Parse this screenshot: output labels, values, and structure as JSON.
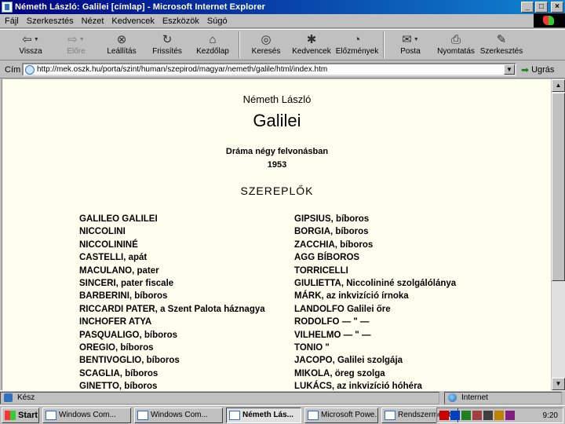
{
  "window": {
    "title": "Németh László: Galilei [címlap] - Microsoft Internet Explorer",
    "min": "_",
    "max": "□",
    "close": "×"
  },
  "menu": [
    "Fájl",
    "Szerkesztés",
    "Nézet",
    "Kedvencek",
    "Eszközök",
    "Súgó"
  ],
  "toolbar": {
    "back": "Vissza",
    "forward": "Előre",
    "stop": "Leállítás",
    "refresh": "Frissítés",
    "home": "Kezdőlap",
    "search": "Keresés",
    "favorites": "Kedvencek",
    "history": "Előzmények",
    "mail": "Posta",
    "print": "Nyomtatás",
    "edit": "Szerkesztés"
  },
  "address": {
    "label": "Cím",
    "url": "http://mek.oszk.hu/porta/szint/human/szepirod/magyar/nemeth/galile/html/index.htm",
    "go": "Ugrás"
  },
  "page": {
    "author": "Németh László",
    "title": "Galilei",
    "genre": "Dráma négy felvonásban",
    "year": "1953",
    "cast_heading": "SZEREPLŐK",
    "cast_left": [
      "GALILEO GALILEI",
      "NICCOLINI",
      "NICCOLININÉ",
      "CASTELLI, apát",
      "MACULANO, pater",
      "SINCERI, pater fiscale",
      "BARBERINI, bíboros",
      "RICCARDI PATER, a Szent Palota háznagya",
      "INCHOFER ATYA",
      "PASQUALIGO, bíboros",
      "OREGIO, bíboros",
      "BENTIVOGLIO, bíboros",
      "SCAGLIA, bíboros",
      "GINETTO, bíboros"
    ],
    "cast_right": [
      "GIPSIUS, bíboros",
      "BORGIA, bíboros",
      "ZACCHIA, bíboros",
      "AGG BÍBOROS",
      "TORRICELLI",
      "GIULIETTA, Niccolininé szolgálólánya",
      "MÁRK, az inkvizíció írnoka",
      "LANDOLFO  Galilei őre",
      "RODOLFO       — \" —",
      "VILHELMO      — \" —",
      "TONIO              \"",
      "JACOPO, Galilei szolgája",
      "MIKOLA, öreg szolga",
      "LUKÁCS, az inkvizíció hóhéra"
    ]
  },
  "status": {
    "left": "Kész",
    "zone": "Internet"
  },
  "taskbar": {
    "start": "Start",
    "tasks": [
      "Windows Com...",
      "Windows Com...",
      "Németh Lás...",
      "Microsoft Powe...",
      "Rendszermonitor"
    ],
    "clock": "9:20"
  }
}
